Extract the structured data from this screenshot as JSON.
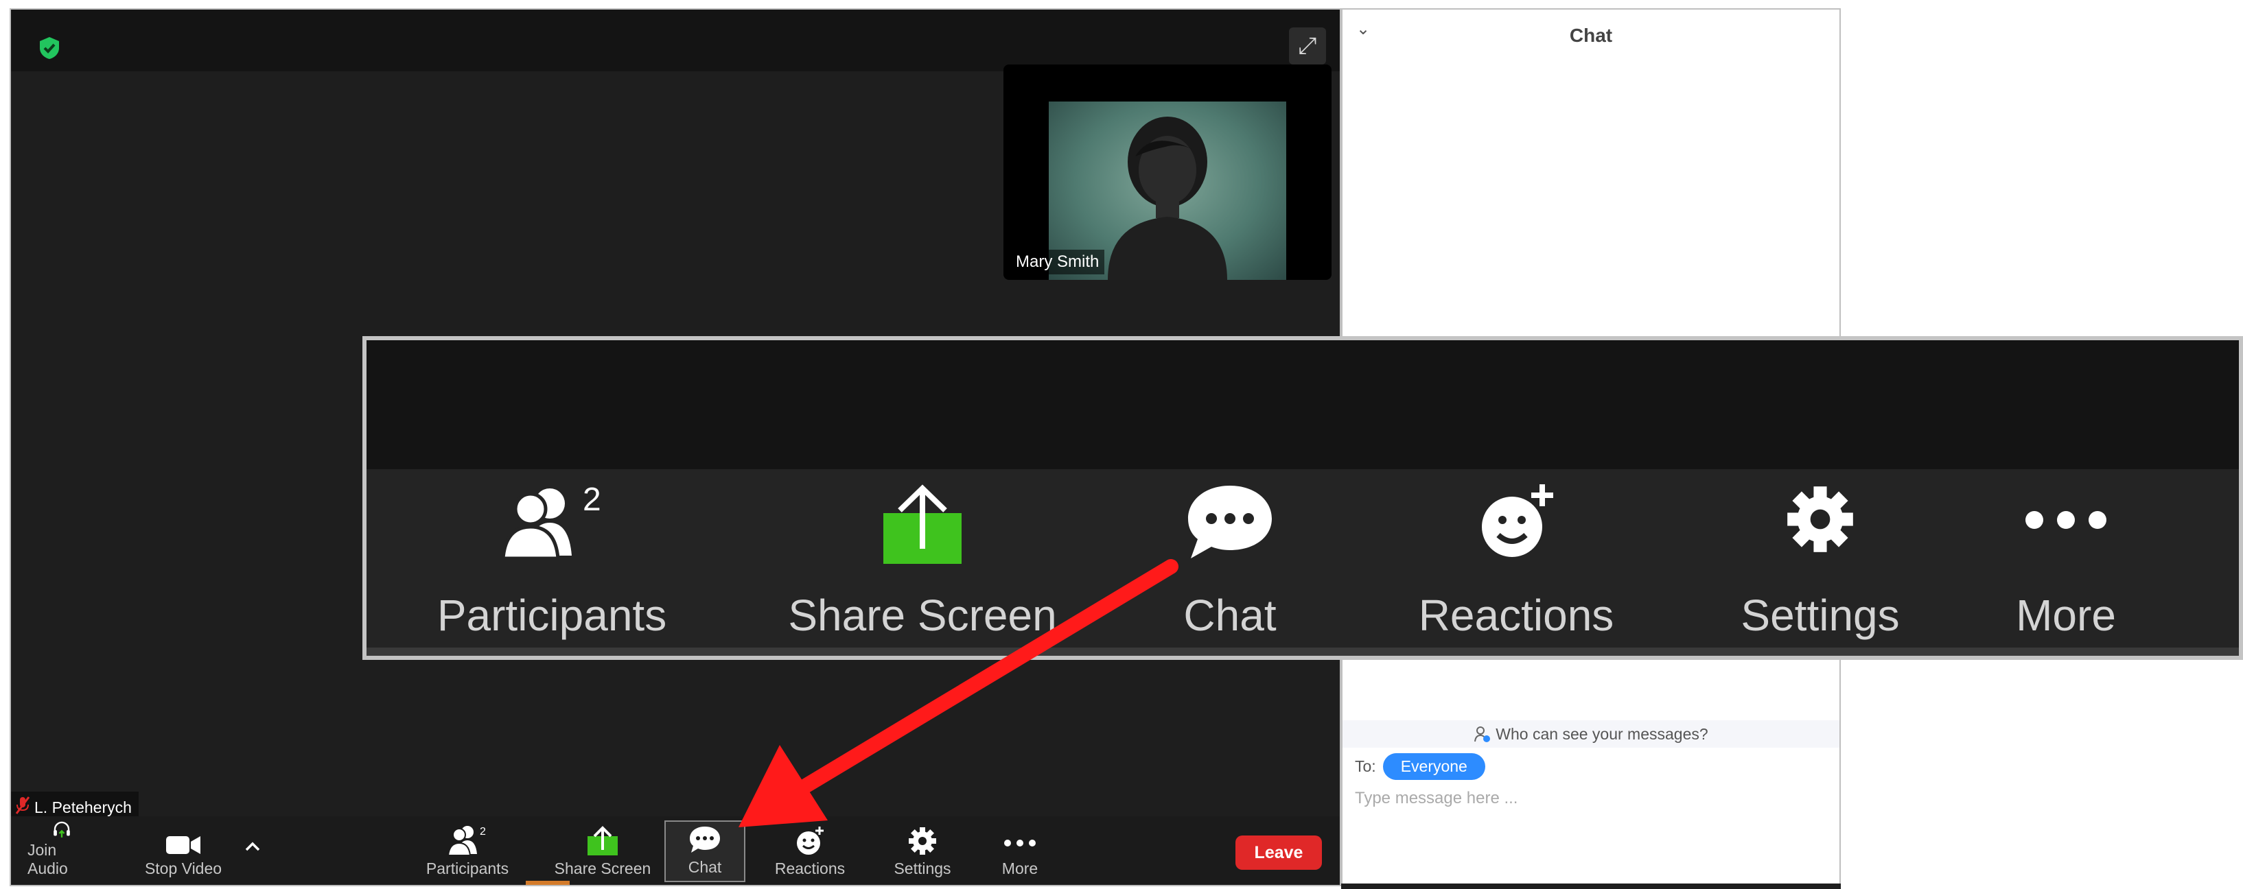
{
  "thumbnail": {
    "name": "Mary Smith"
  },
  "self_view": {
    "name": "L. Peteherych"
  },
  "toolbar": {
    "join_audio": "Join Audio",
    "stop_video": "Stop Video",
    "participants": "Participants",
    "participants_count": "2",
    "share_screen": "Share Screen",
    "chat": "Chat",
    "reactions": "Reactions",
    "settings": "Settings",
    "more": "More",
    "leave": "Leave"
  },
  "chat_panel": {
    "title": "Chat",
    "who_can_see": "Who can see your messages?",
    "to_label": "To:",
    "recipient": "Everyone",
    "placeholder": "Type message here ..."
  },
  "zoom_callout": {
    "participants": "Participants",
    "participants_count": "2",
    "share_screen": "Share Screen",
    "chat": "Chat",
    "reactions": "Reactions",
    "settings": "Settings",
    "more": "More"
  },
  "colors": {
    "share_green": "#3fc31e",
    "leave_red": "#e02828",
    "accent_blue": "#2d8cff",
    "arrow_red": "#ff1a1a"
  },
  "icons": [
    "shield-icon",
    "expand-icon",
    "headphones-icon",
    "camera-icon",
    "caret-up-icon",
    "participants-icon",
    "share-screen-icon",
    "chat-bubble-icon",
    "reactions-icon",
    "gear-icon",
    "more-dots-icon",
    "mic-muted-icon",
    "person-lock-icon",
    "chevron-down-icon"
  ]
}
